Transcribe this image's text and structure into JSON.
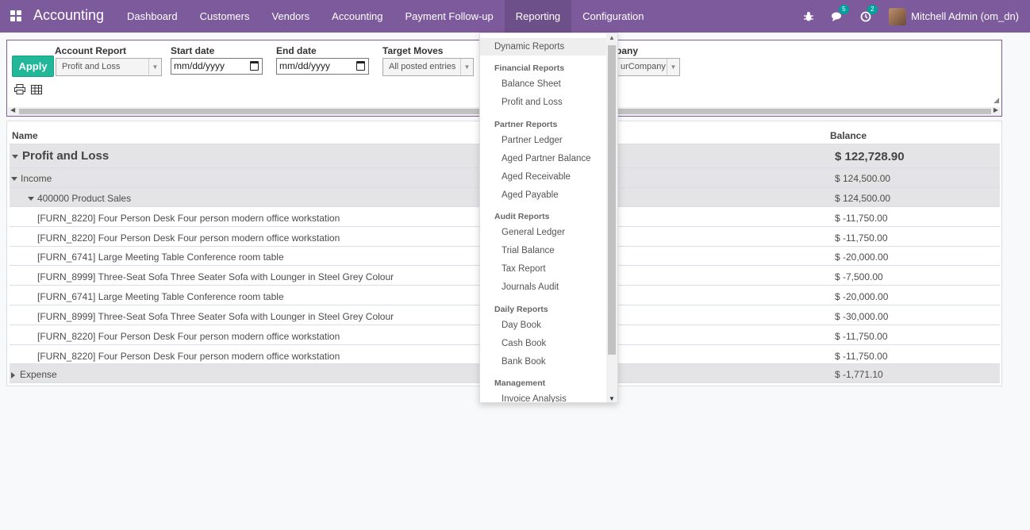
{
  "navbar": {
    "app_title": "Accounting",
    "menu": [
      {
        "label": "Dashboard"
      },
      {
        "label": "Customers"
      },
      {
        "label": "Vendors"
      },
      {
        "label": "Accounting"
      },
      {
        "label": "Payment Follow-up"
      },
      {
        "label": "Reporting"
      },
      {
        "label": "Configuration"
      }
    ],
    "active_menu": "Reporting",
    "messages_badge": "5",
    "activities_badge": "2",
    "user_name": "Mitchell Admin (om_dn)",
    "accent_color": "#7c5a9b"
  },
  "filters": {
    "apply_label": "Apply",
    "account_report_label": "Account Report",
    "account_report_value": "Profit and Loss",
    "start_date_label": "Start date",
    "start_date_placeholder": "mm/dd/yyyy",
    "end_date_label": "End date",
    "end_date_placeholder": "mm/dd/yyyy",
    "target_moves_label": "Target Moves",
    "target_moves_value": "All posted entries",
    "company_label": "pany",
    "company_value": "urCompany"
  },
  "report": {
    "col_name": "Name",
    "col_balance": "Balance",
    "rows": [
      {
        "name": "Profit and Loss",
        "balance": "$ 122,728.90"
      },
      {
        "name": "Income",
        "balance": "$ 124,500.00"
      },
      {
        "name": "400000 Product Sales",
        "balance": "$ 124,500.00"
      },
      {
        "name": "[FURN_8220] Four Person Desk Four person modern office workstation",
        "balance": "$ -11,750.00"
      },
      {
        "name": "[FURN_8220] Four Person Desk Four person modern office workstation",
        "balance": "$ -11,750.00"
      },
      {
        "name": "[FURN_6741] Large Meeting Table Conference room table",
        "balance": "$ -20,000.00"
      },
      {
        "name": "[FURN_8999] Three-Seat Sofa Three Seater Sofa with Lounger in Steel Grey Colour",
        "balance": "$ -7,500.00"
      },
      {
        "name": "[FURN_6741] Large Meeting Table Conference room table",
        "balance": "$ -20,000.00"
      },
      {
        "name": "[FURN_8999] Three-Seat Sofa Three Seater Sofa with Lounger in Steel Grey Colour",
        "balance": "$ -30,000.00"
      },
      {
        "name": "[FURN_8220] Four Person Desk Four person modern office workstation",
        "balance": "$ -11,750.00"
      },
      {
        "name": "[FURN_8220] Four Person Desk Four person modern office workstation",
        "balance": "$ -11,750.00"
      },
      {
        "name": "Expense",
        "balance": "$ -1,771.10"
      }
    ]
  },
  "reporting_menu": {
    "dynamic_reports": "Dynamic Reports",
    "financial_head": "Financial Reports",
    "balance_sheet": "Balance Sheet",
    "profit_and_loss": "Profit and Loss",
    "partner_head": "Partner Reports",
    "partner_ledger": "Partner Ledger",
    "aged_partner_balance": "Aged Partner Balance",
    "aged_receivable": "Aged Receivable",
    "aged_payable": "Aged Payable",
    "audit_head": "Audit Reports",
    "general_ledger": "General Ledger",
    "trial_balance": "Trial Balance",
    "tax_report": "Tax Report",
    "journals_audit": "Journals Audit",
    "daily_head": "Daily Reports",
    "day_book": "Day Book",
    "cash_book": "Cash Book",
    "bank_book": "Bank Book",
    "management_head": "Management",
    "invoice_analysis": "Invoice Analysis"
  }
}
